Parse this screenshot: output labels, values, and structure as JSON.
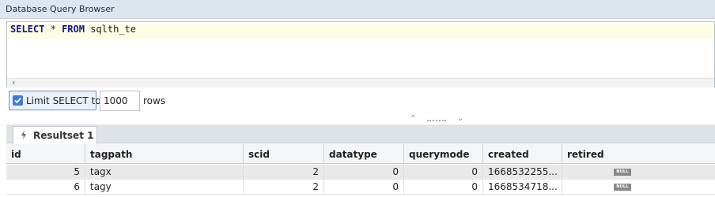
{
  "window": {
    "title": "Database Query Browser"
  },
  "editor": {
    "kw1": "SELECT",
    "star": "*",
    "kw2": "FROM",
    "table": "sqlth_te",
    "scroll_left_glyph": "‹"
  },
  "limit": {
    "checked": true,
    "label": "Limit SELECT to:",
    "value": "1000",
    "suffix": "rows"
  },
  "splitter": {
    "up_glyph": "⌃",
    "down_glyph": "⌄"
  },
  "results": {
    "tab_label": "Resultset 1",
    "tab_icon": "lightning-icon",
    "columns": [
      "id",
      "tagpath",
      "scid",
      "datatype",
      "querymode",
      "created",
      "retired"
    ],
    "rows": [
      {
        "id": "5",
        "tagpath": "tagx",
        "scid": "2",
        "datatype": "0",
        "querymode": "0",
        "created": "1668532255...",
        "retired": "NULL"
      },
      {
        "id": "6",
        "tagpath": "tagy",
        "scid": "2",
        "datatype": "0",
        "querymode": "0",
        "created": "1668534718...",
        "retired": "NULL"
      }
    ]
  }
}
